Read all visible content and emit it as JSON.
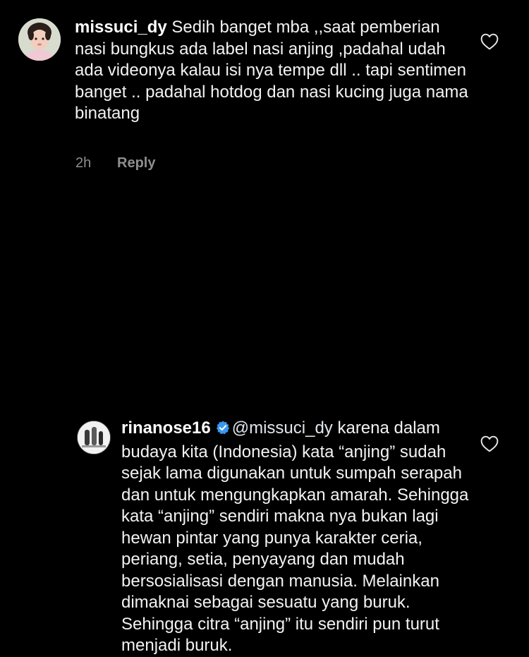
{
  "comments": [
    {
      "username": "missuci_dy",
      "text": " Sedih banget mba ,,saat pemberian nasi bungkus ada label nasi anjing ,padahal udah ada videonya kalau isi nya tempe dll .. tapi sentimen banget .. padahal hotdog dan nasi kucing juga nama binatang",
      "time": "2h",
      "reply_label": "Reply"
    },
    {
      "username": "rinanose16",
      "mention": "@missuci_dy",
      "text": "  karena dalam budaya kita (Indonesia) kata “anjing” sudah sejak lama digunakan untuk sumpah serapah dan untuk mengungkapkan amarah. Sehingga kata “anjing” sendiri makna nya bukan lagi hewan pintar yang punya karakter ceria, periang, setia, penyayang dan mudah bersosialisasi dengan manusia. Melainkan dimaknai sebagai sesuatu yang buruk. Sehingga citra “anjing” itu sendiri pun turut menjadi buruk."
    }
  ],
  "icons": {
    "like": "heart-outline-icon",
    "verified": "verified-badge-icon"
  },
  "colors": {
    "background": "#000000",
    "text": "#f2f2f2",
    "muted": "#8e8e8e",
    "verified": "#3897f0"
  }
}
